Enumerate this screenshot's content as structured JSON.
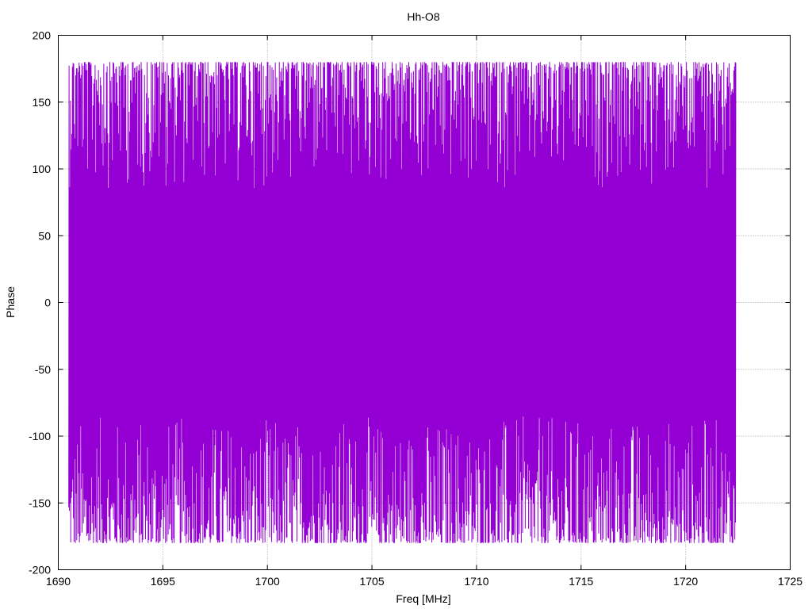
{
  "chart_data": {
    "type": "line",
    "title": "Hh-O8",
    "xlabel": "Freq [MHz]",
    "ylabel": "Phase",
    "xlim": [
      1690,
      1725
    ],
    "ylim": [
      -200,
      200
    ],
    "xticks": [
      1690,
      1695,
      1700,
      1705,
      1710,
      1715,
      1720,
      1725
    ],
    "yticks": [
      -200,
      -150,
      -100,
      -50,
      0,
      50,
      100,
      150,
      200
    ],
    "grid": true,
    "series": [
      {
        "color": "#9400d3",
        "x_start": 1690.5,
        "x_end": 1722.4,
        "point_count": 2000,
        "y_min": -180,
        "y_max": 180
      }
    ]
  }
}
